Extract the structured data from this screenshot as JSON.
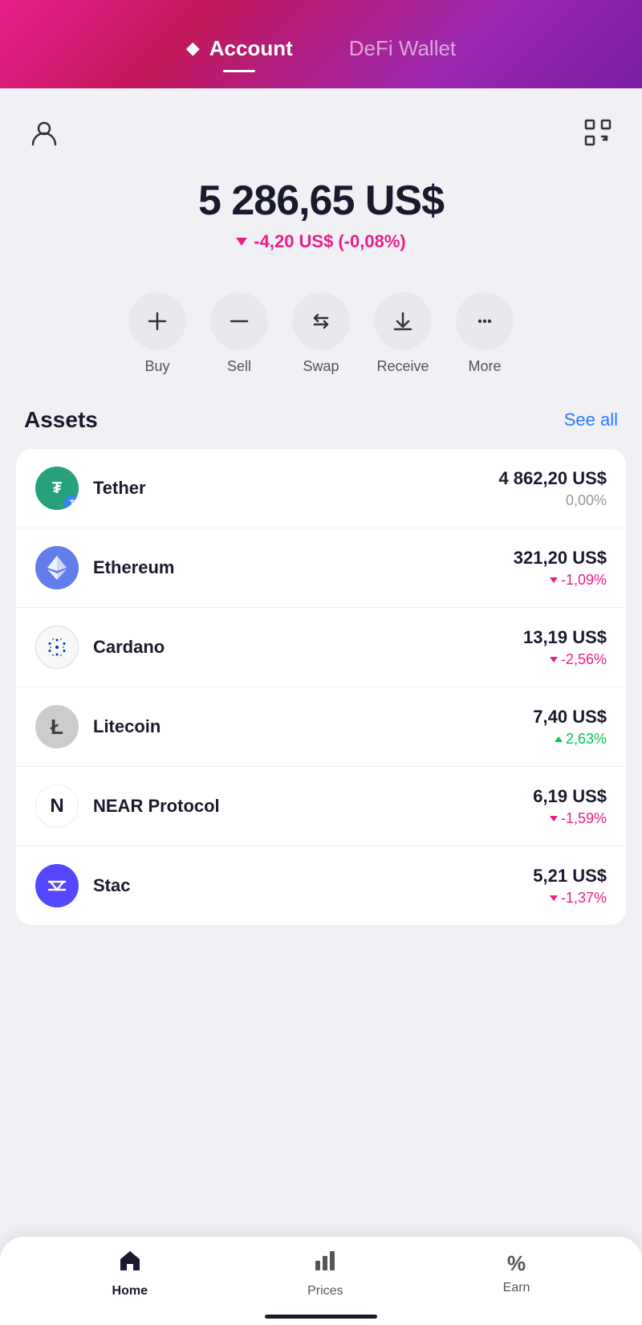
{
  "header": {
    "active_tab": "Account",
    "inactive_tab": "DeFi Wallet",
    "diamond_icon": "◆"
  },
  "balance": {
    "amount": "5 286,65 US$",
    "change_amount": "-4,20 US$",
    "change_percent": "(-0,08%)"
  },
  "actions": [
    {
      "id": "buy",
      "icon": "+",
      "label": "Buy"
    },
    {
      "id": "sell",
      "icon": "−",
      "label": "Sell"
    },
    {
      "id": "swap",
      "icon": "⇄",
      "label": "Swap"
    },
    {
      "id": "receive",
      "icon": "↓",
      "label": "Receive"
    },
    {
      "id": "more",
      "icon": "···",
      "label": "More"
    }
  ],
  "assets": {
    "section_title": "Assets",
    "see_all_label": "See all",
    "items": [
      {
        "name": "Tether",
        "amount": "4 862,20 US$",
        "change": "0,00%",
        "change_type": "neutral",
        "logo_text": "₮",
        "logo_type": "tether"
      },
      {
        "name": "Ethereum",
        "amount": "321,20 US$",
        "change": "-1,09%",
        "change_type": "down",
        "logo_text": "Ξ",
        "logo_type": "eth"
      },
      {
        "name": "Cardano",
        "amount": "13,19 US$",
        "change": "-2,56%",
        "change_type": "down",
        "logo_text": "ADA",
        "logo_type": "ada"
      },
      {
        "name": "Litecoin",
        "amount": "7,40 US$",
        "change": "2,63%",
        "change_type": "up",
        "logo_text": "Ł",
        "logo_type": "ltc"
      },
      {
        "name": "NEAR Protocol",
        "amount": "6,19 US$",
        "change": "-1,59%",
        "change_type": "down",
        "logo_text": "Ν",
        "logo_type": "near"
      },
      {
        "name": "Stac",
        "amount": "5,21 US$",
        "change": "-1,37%",
        "change_type": "down",
        "logo_text": "✳",
        "logo_type": "stx"
      }
    ]
  },
  "bottom_nav": {
    "items": [
      {
        "id": "home",
        "icon": "🏠",
        "label": "Home",
        "active": true
      },
      {
        "id": "prices",
        "icon": "📊",
        "label": "Prices",
        "active": false
      },
      {
        "id": "earn",
        "icon": "%",
        "label": "Earn",
        "active": false
      }
    ]
  }
}
